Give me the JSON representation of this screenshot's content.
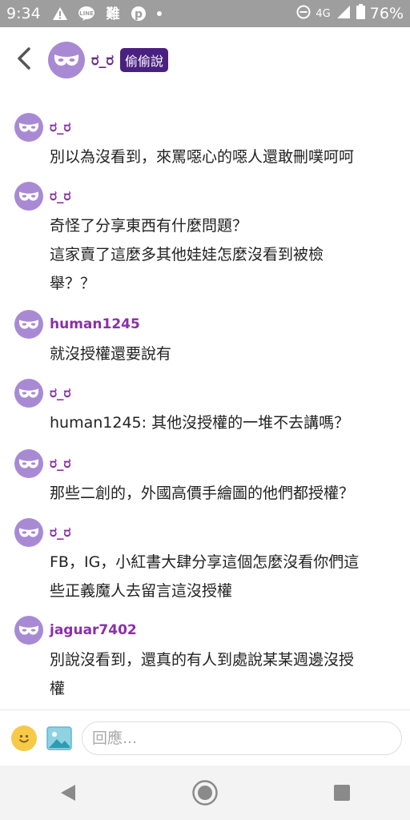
{
  "status_bar": {
    "time": "9:34",
    "network": "4G",
    "battery": "76%",
    "icons": [
      "warning-icon",
      "line-icon",
      "translate-icon",
      "pinterest-icon",
      "dot-icon"
    ]
  },
  "header": {
    "name": "ರ_ರ",
    "badge": "偷偷說"
  },
  "comments": [
    {
      "name": "ರ_ರ",
      "text": "別以為沒看到，來罵噁心的噁人還敢刪噗呵呵"
    },
    {
      "name": "ರ_ರ",
      "text": "奇怪了分享東西有什麼問題？\n這家賣了這麼多其他娃娃怎麼沒看到被檢\n舉？？"
    },
    {
      "name": "human1245",
      "text": "就沒授權還要說有"
    },
    {
      "name": "ರ_ರ",
      "text": "human1245: 其他沒授權的一堆不去講嗎？"
    },
    {
      "name": "ರ_ರ",
      "text": "那些二創的，外國高價手繪圖的他們都授權？"
    },
    {
      "name": "ರ_ರ",
      "text": "FB，IG，小紅書大肆分享這個怎麼沒看你們這\n些正義魔人去留言這沒授權"
    },
    {
      "name": "jaguar7402",
      "text": "別說沒看到，還真的有人到處說某某週邊沒授\n權"
    }
  ],
  "reply": {
    "placeholder": "回應..."
  },
  "colors": {
    "avatar": "#a88ad4",
    "name": "#8b2fa8",
    "badge": "#4a2080"
  }
}
